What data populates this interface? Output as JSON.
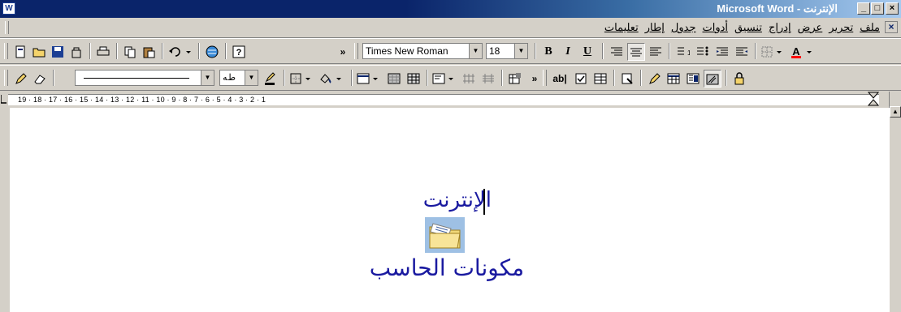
{
  "window": {
    "title": "Microsoft Word - الإنترنت",
    "app_icon": "word-icon",
    "caption_buttons": {
      "minimize": "_",
      "maximize": "□",
      "close": "×"
    }
  },
  "menu": {
    "items": [
      "ملف",
      "تحرير",
      "عرض",
      "إدراج",
      "تنسيق",
      "أدوات",
      "جدول",
      "إطار",
      "تعليمات"
    ],
    "doc_close": "×"
  },
  "formatting": {
    "font_name": "Times New Roman",
    "font_size": "18",
    "bold": "B",
    "italic": "I",
    "underline": "U",
    "more": "»"
  },
  "drawing": {
    "line_style_value": "",
    "text_direction": "ﻁﻪ",
    "more": "»",
    "form_field_label": "ab|"
  },
  "ruler": {
    "numbers": "19 · 18 · 17 · 16 · 15 · 14 · 13 · 12 · 11 · 10 · 9 · 8 · 7 · 6 · 5 · 4 · 3 · 2 · 1"
  },
  "document": {
    "heading": "الإنترنت",
    "icon": "folder-icon",
    "caption": "مكونات الحاسب"
  }
}
